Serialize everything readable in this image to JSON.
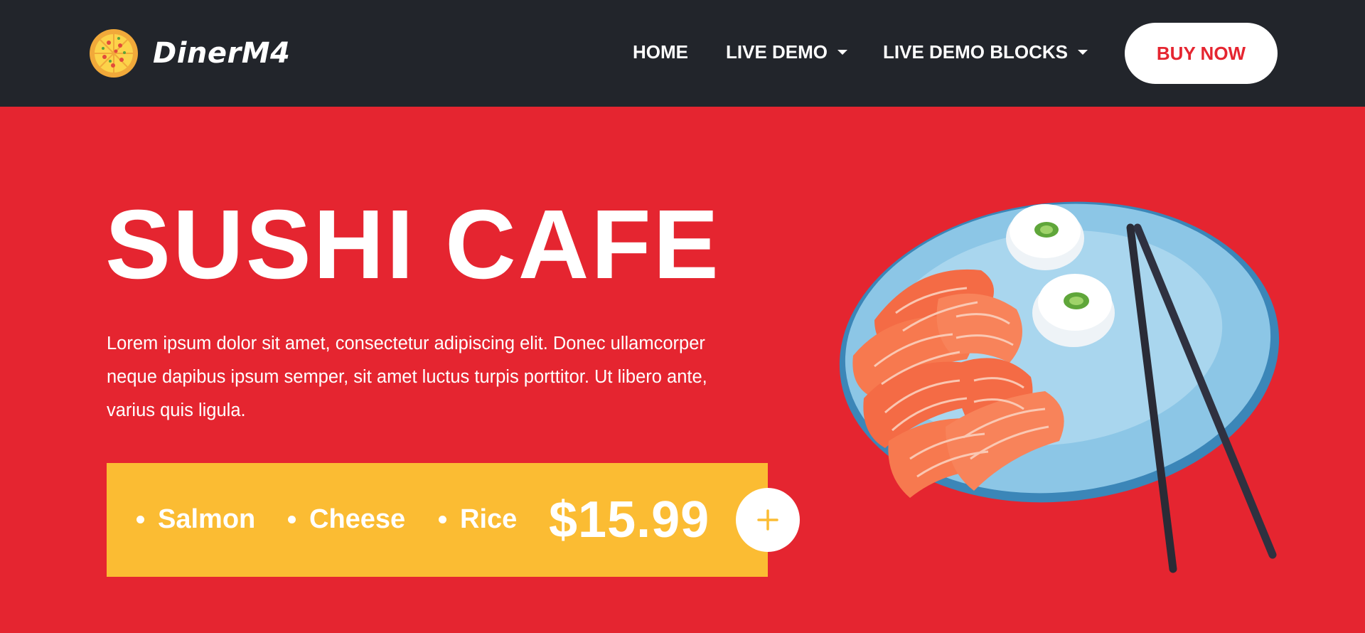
{
  "brand": {
    "name": "DinerM4",
    "logo_icon": "pizza-icon"
  },
  "nav": {
    "items": [
      {
        "label": "HOME",
        "dropdown": false
      },
      {
        "label": "LIVE DEMO",
        "dropdown": true
      },
      {
        "label": "LIVE DEMO BLOCKS",
        "dropdown": true
      }
    ],
    "cta_label": "BUY NOW"
  },
  "hero": {
    "title": "SUSHI CAFE",
    "description": "Lorem ipsum dolor sit amet, consectetur adipiscing elit. Donec ullamcorper neque dapibus ipsum semper, sit amet luctus turpis porttitor. Ut libero ante, varius quis ligula.",
    "ingredients": [
      "Salmon",
      "Cheese",
      "Rice"
    ],
    "price": "$15.99",
    "add_icon": "plus-icon",
    "image": "sushi-plate-image"
  },
  "colors": {
    "background": "#e52530",
    "navbar": "#22252b",
    "card": "#fbbc33",
    "accent": "#e52530",
    "text": "#ffffff"
  }
}
